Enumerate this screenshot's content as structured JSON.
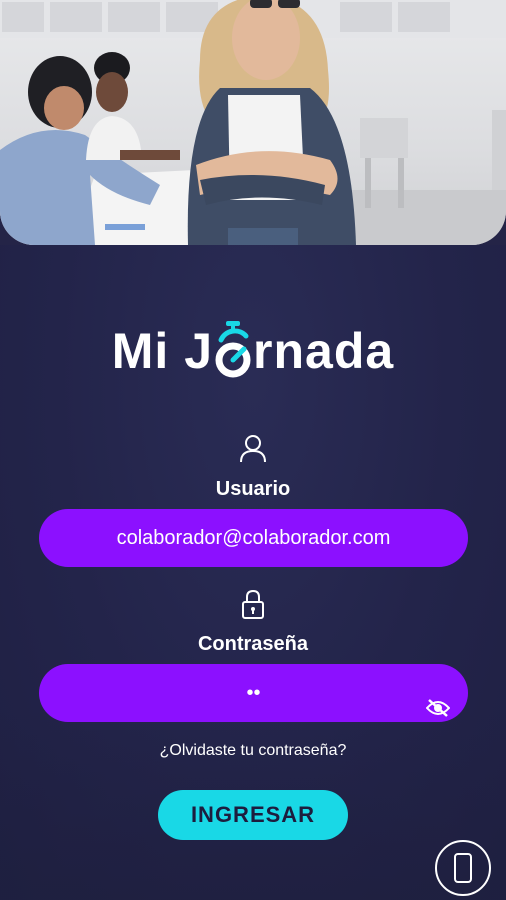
{
  "brand": {
    "logo_parts": [
      "Mi J",
      "rnada"
    ],
    "logo_text": "Mi Jornada",
    "accent": "#19d8e6",
    "field_color": "#8c10ff",
    "background": "#242447"
  },
  "login": {
    "user_label": "Usuario",
    "user_value": "colaborador@colaborador.com",
    "password_label": "Contraseña",
    "password_value": "••",
    "forgot_link": "¿Olvidaste tu contraseña?",
    "submit_label": "INGRESAR"
  },
  "icons": [
    "user-icon",
    "lock-icon",
    "eye-off-icon",
    "stopwatch-icon",
    "phone-icon"
  ]
}
